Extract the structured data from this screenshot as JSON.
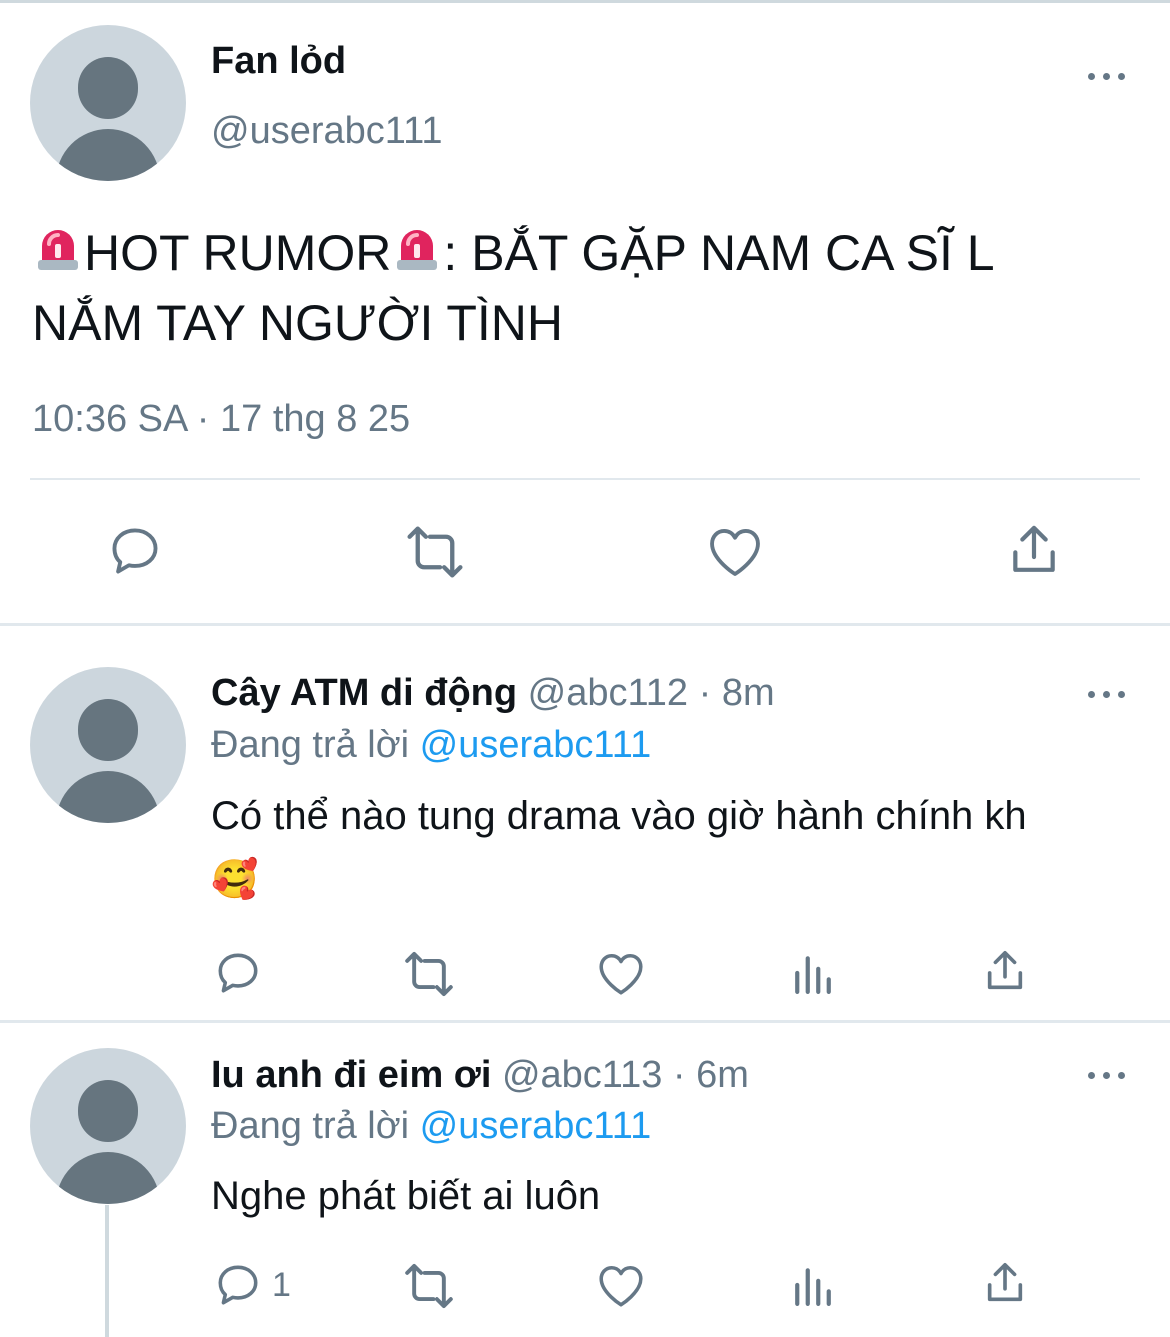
{
  "main_tweet": {
    "display_name": "Fan lỏd",
    "handle": "@userabc111",
    "text_part1": "HOT RUMOR",
    "text_part2": ": BẮT GẶP NAM CA SĨ L",
    "text_line2": "NẮM TAY NGƯỜI TÌNH",
    "timestamp": "10:36 SA · 17 thg 8 25",
    "icons": [
      "reply-icon",
      "retweet-icon",
      "like-icon",
      "share-icon"
    ]
  },
  "replies": [
    {
      "display_name": "Cây ATM di động",
      "handle_time": "@abc112 · 8m",
      "replying_label": "Đang trả lời",
      "replying_to": "@userabc111",
      "text": "Có thể nào tung drama vào giờ hành chính kh",
      "emoji": "🥰",
      "reply_count": "",
      "icons": [
        "reply-icon",
        "retweet-icon",
        "like-icon",
        "analytics-icon",
        "share-icon"
      ]
    },
    {
      "display_name": "Iu anh đi eim ơi",
      "handle_time": "@abc113 · 6m",
      "replying_label": "Đang trả lời",
      "replying_to": "@userabc111",
      "text": "Nghe phát biết ai luôn",
      "reply_count": "1",
      "icons": [
        "reply-icon",
        "retweet-icon",
        "like-icon",
        "analytics-icon",
        "share-icon"
      ]
    }
  ],
  "colors": {
    "text": "#0f1419",
    "muted": "#657786",
    "link": "#1d9bf0",
    "avatar_bg": "#ccd6dd",
    "avatar_fg": "#66757f",
    "siren": "#e0245e"
  }
}
